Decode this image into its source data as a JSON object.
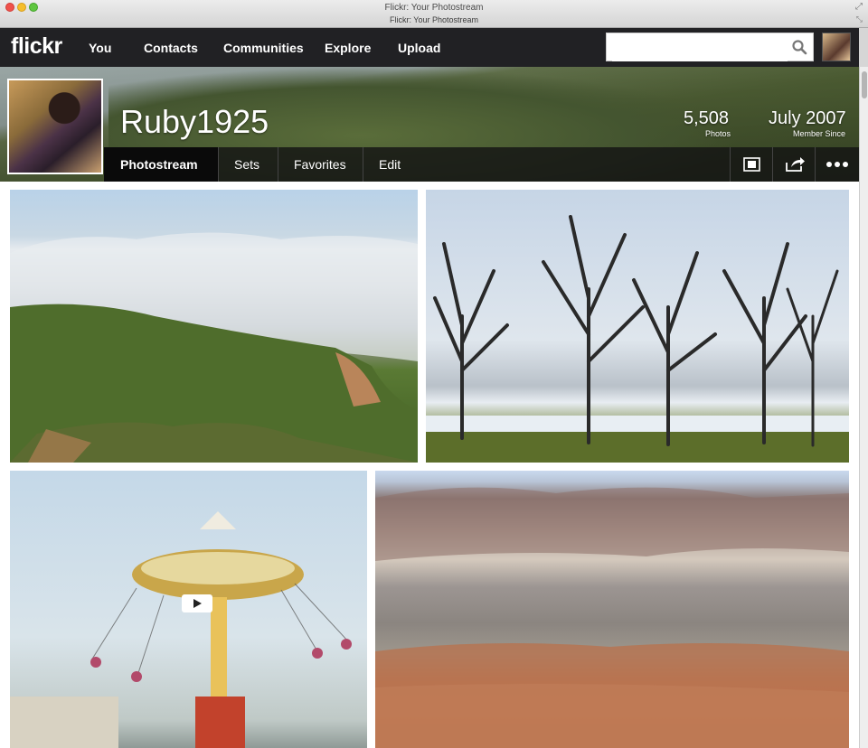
{
  "window": {
    "title": "Flickr: Your Photostream",
    "tab_title": "Flickr: Your Photostream"
  },
  "navbar": {
    "logo": "flickr",
    "items": [
      {
        "label": "You"
      },
      {
        "label": "Contacts"
      },
      {
        "label": "Communities"
      },
      {
        "label": "Explore"
      },
      {
        "label": "Upload"
      }
    ],
    "search": {
      "value": "",
      "placeholder": ""
    },
    "icons": {
      "search": "search-icon",
      "avatar": "user-avatar"
    }
  },
  "profile": {
    "username": "Ruby1925",
    "photos_count": "5,508",
    "photos_label": "Photos",
    "member_since": "July 2007",
    "member_since_label": "Member Since"
  },
  "subnav": {
    "tabs": [
      {
        "label": "Photostream",
        "active": true
      },
      {
        "label": "Sets"
      },
      {
        "label": "Favorites"
      },
      {
        "label": "Edit"
      }
    ],
    "icons": [
      "slideshow-icon",
      "share-icon",
      "more-icon"
    ]
  },
  "photos": [
    {
      "subject": "coastal hillside with fog",
      "is_video": false
    },
    {
      "subject": "bare trees by water",
      "is_video": false
    },
    {
      "subject": "swing carousel ride",
      "is_video": true
    },
    {
      "subject": "desert badlands",
      "is_video": false
    }
  ],
  "colors": {
    "navbar_bg": "#212124",
    "subnav_bg": "#141414",
    "text_light": "#ffffff"
  }
}
